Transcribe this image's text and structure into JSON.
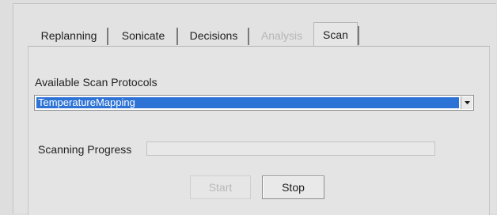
{
  "tabs": [
    {
      "label": "Replanning",
      "state": "normal"
    },
    {
      "label": "Sonicate",
      "state": "normal"
    },
    {
      "label": "Decisions",
      "state": "normal"
    },
    {
      "label": "Analysis",
      "state": "disabled"
    },
    {
      "label": "Scan",
      "state": "active"
    }
  ],
  "scan": {
    "protocols_label": "Available Scan Protocols",
    "selected_protocol": "TemperatureMapping",
    "progress_label": "Scanning Progress",
    "progress_fraction": 0,
    "start_label": "Start",
    "stop_label": "Stop"
  },
  "colors": {
    "selection": "#2d73d6",
    "disabled_text": "#b6b6b6"
  }
}
